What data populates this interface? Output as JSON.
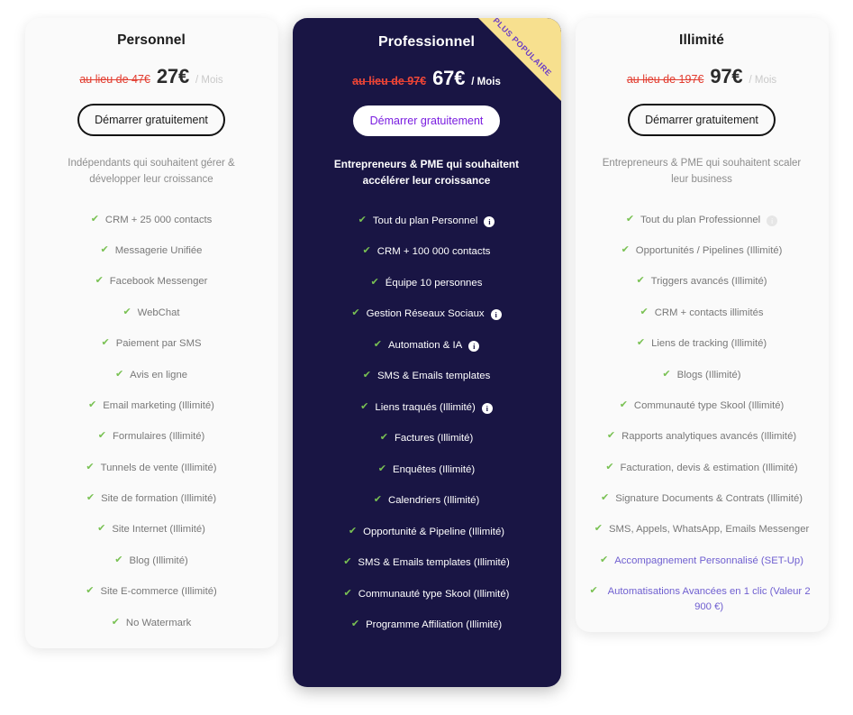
{
  "colors": {
    "featured_bg": "#191544",
    "page_bg": "#ffffff",
    "card_bg": "#fafafa",
    "check_green": "#79c153",
    "old_price_red": "#e23b2e",
    "cta_purple": "#7a1de0",
    "ribbon_yellow": "#f7e08f",
    "ribbon_text_purple": "#6d3fc4",
    "accent_feature": "#6f5fd0"
  },
  "plans": [
    {
      "id": "personnel",
      "name": "Personnel",
      "old_price": "au lieu de 47€",
      "price": "27€",
      "period": "/ Mois",
      "cta_label": "Démarrer gratuitement",
      "description": "Indépendants qui souhaitent gérer & développer leur croissance",
      "features": [
        {
          "label": "CRM + 25 000 contacts",
          "info": false
        },
        {
          "label": "Messagerie Unifiée",
          "info": false
        },
        {
          "label": "Facebook Messenger",
          "info": false
        },
        {
          "label": "WebChat",
          "info": false
        },
        {
          "label": "Paiement par SMS",
          "info": false
        },
        {
          "label": "Avis en ligne",
          "info": false
        },
        {
          "label": "Email marketing (Illimité)",
          "info": false
        },
        {
          "label": "Formulaires (Illimité)",
          "info": false
        },
        {
          "label": "Tunnels de vente (Illimité)",
          "info": false
        },
        {
          "label": "Site de formation (Illimité)",
          "info": false
        },
        {
          "label": "Site Internet (Illimité)",
          "info": false
        },
        {
          "label": "Blog (Illimité)",
          "info": false
        },
        {
          "label": "Site E-commerce (Illimité)",
          "info": false
        },
        {
          "label": "No Watermark",
          "info": false
        }
      ]
    },
    {
      "id": "professionnel",
      "name": "Professionnel",
      "badge": "PLUS POPULAIRE",
      "old_price": "au lieu de 97€",
      "price": "67€",
      "period": "/ Mois",
      "cta_label": "Démarrer gratuitement",
      "description": "Entrepreneurs & PME qui souhaitent accélérer leur croissance",
      "features": [
        {
          "label": "Tout du plan Personnel",
          "info": true
        },
        {
          "label": "CRM + 100 000 contacts",
          "info": false
        },
        {
          "label": "Équipe 10 personnes",
          "info": false
        },
        {
          "label": "Gestion Réseaux Sociaux",
          "info": true
        },
        {
          "label": "Automation & IA",
          "info": true
        },
        {
          "label": "SMS & Emails templates",
          "info": false
        },
        {
          "label": "Liens traqués (Illimité)",
          "info": true
        },
        {
          "label": "Factures (Illimité)",
          "info": false
        },
        {
          "label": "Enquêtes (Illimité)",
          "info": false
        },
        {
          "label": "Calendriers (Illimité)",
          "info": false
        },
        {
          "label": "Opportunité & Pipeline (Illimité)",
          "info": false
        },
        {
          "label": "SMS & Emails templates (Illimité)",
          "info": false
        },
        {
          "label": "Communauté type Skool (Illimité)",
          "info": false
        },
        {
          "label": "Programme Affiliation (Illimité)",
          "info": false
        }
      ]
    },
    {
      "id": "illimite",
      "name": "Illimité",
      "old_price": "au lieu de 197€",
      "price": "97€",
      "period": "/ Mois",
      "cta_label": "Démarrer gratuitement",
      "description": "Entrepreneurs & PME qui souhaitent scaler leur business",
      "features": [
        {
          "label": "Tout du plan Professionnel",
          "info": true,
          "info_faint": true
        },
        {
          "label": "Opportunités / Pipelines (Illimité)",
          "info": false
        },
        {
          "label": "Triggers avancés (Illimité)",
          "info": false
        },
        {
          "label": "CRM + contacts illimités",
          "info": false
        },
        {
          "label": "Liens de tracking (Illimité)",
          "info": false
        },
        {
          "label": "Blogs (Illimité)",
          "info": false
        },
        {
          "label": "Communauté type Skool (Illimité)",
          "info": false
        },
        {
          "label": "Rapports analytiques avancés (Illimité)",
          "info": false
        },
        {
          "label": "Facturation, devis & estimation (Illimité)",
          "info": false
        },
        {
          "label": "Signature Documents & Contrats (Illimité)",
          "info": false
        },
        {
          "label": "SMS, Appels, WhatsApp, Emails Messenger",
          "info": false
        },
        {
          "label": "Accompagnement Personnalisé (SET-Up)",
          "info": false,
          "accent": true
        },
        {
          "label": "Automatisations Avancées en 1 clic (Valeur 2 900 €)",
          "info": false,
          "accent": true
        }
      ]
    }
  ]
}
